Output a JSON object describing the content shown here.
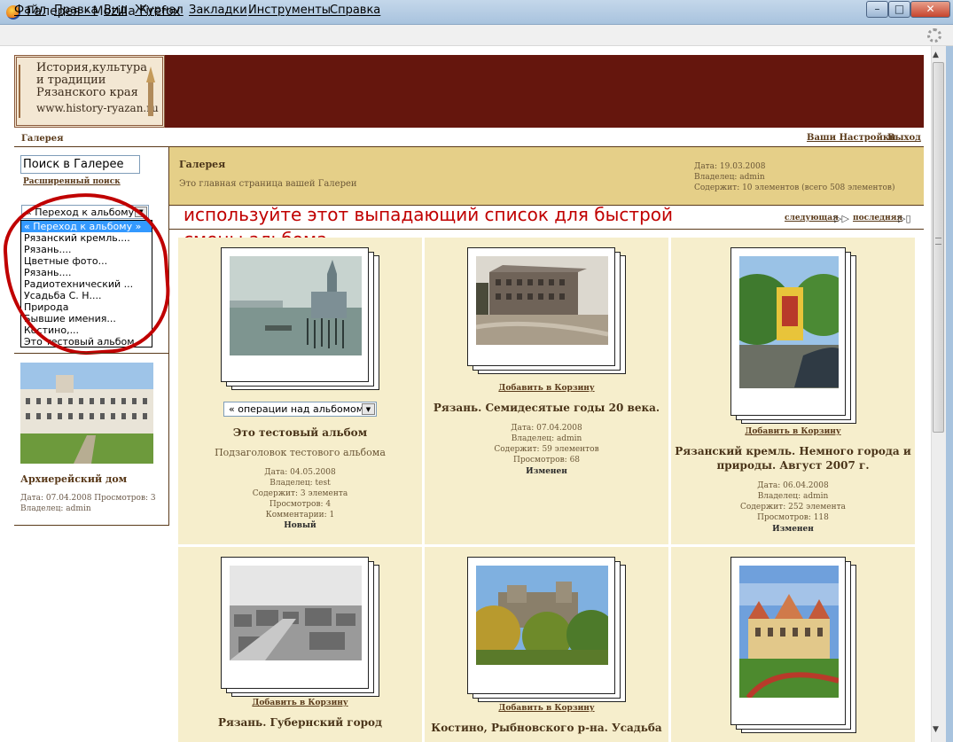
{
  "window": {
    "title": "Галерея - Mozilla Firefox",
    "min": "–",
    "max": "□",
    "close": "✕"
  },
  "menu": [
    "Файл",
    "Правка",
    "Вид",
    "Журнал",
    "Закладки",
    "Инструменты",
    "Справка"
  ],
  "header": {
    "logo_lines": [
      "История,культура",
      "и традиции",
      "Рязанского края",
      "www.history-ryazan.ru"
    ],
    "breadcrumb": "Галерея",
    "settings_link": "Ваши Настройки",
    "logout_link": "Выход"
  },
  "sidebar": {
    "search_value": "Поиск в Галерее",
    "advanced_search": "Расширенный поиск",
    "album_select": "« Переход к альбому »",
    "album_options": [
      "« Переход к альбому »",
      "Рязанский кремль....",
      "Рязань....",
      "Цветные фото...",
      "Рязань....",
      "Радиотехнический ...",
      "Усадьба С. Н....",
      "Природа",
      "Бывшие имения...",
      "Костино,...",
      "Это тестовый альбом"
    ],
    "selected_index": 0,
    "random_photo": {
      "title": "Архиерейский дом",
      "meta_line1": "Дата: 07.04.2008 Просмотров: 3",
      "meta_line2": "Владелец: admin"
    }
  },
  "annotation": {
    "hint_line1": "используйте этот выпадающий список для быстрой",
    "hint_line2": "смены альбома"
  },
  "gallery": {
    "title": "Галерея",
    "description": "Это главная страница вашей Галереи",
    "date": "Дата: 19.03.2008",
    "owner": "Владелец: admin",
    "contents": "Содержит: 10 элементов (всего 508 элементов)",
    "next": "следующая",
    "last": "последняя"
  },
  "albums": [
    {
      "title": "Это тестовый альбом",
      "subtitle": "Подзаголовок тестового альбома",
      "ops": "« операции над альбомом »",
      "meta": [
        "Дата: 04.05.2008",
        "Владелец: test",
        "Содержит: 3 элемента",
        "Просмотров: 4",
        "Комментарии: 1"
      ],
      "status": "Новый"
    },
    {
      "cart": "Добавить в Корзину",
      "title": "Рязань. Семидесятые годы 20 века.",
      "meta": [
        "Дата: 07.04.2008",
        "Владелец: admin",
        "Содержит: 59 элементов",
        "Просмотров: 68"
      ],
      "status": "Изменен"
    },
    {
      "cart": "Добавить в Корзину",
      "title_line1": "Рязанский кремль. Немного города и",
      "title_line2": "природы. Август 2007 г.",
      "meta": [
        "Дата: 06.04.2008",
        "Владелец: admin",
        "Содержит: 252 элемента",
        "Просмотров: 118"
      ],
      "status": "Изменен"
    },
    {
      "cart": "Добавить в Корзину",
      "title": "Рязань. Губернский город"
    },
    {
      "cart": "Добавить в Корзину",
      "title": "Костино, Рыбновского р-на. Усадьба"
    },
    {}
  ],
  "icons": {
    "next": "▷▷",
    "last": "▷▯",
    "dropdown": "▼",
    "scroll_up": "▲",
    "scroll_down": "▼"
  },
  "colors": {
    "banner": "#65160d",
    "info_bar": "#e5cf88",
    "cell_bg": "#f6eecc",
    "annotation": "#c00000",
    "selection": "#3399ff"
  }
}
